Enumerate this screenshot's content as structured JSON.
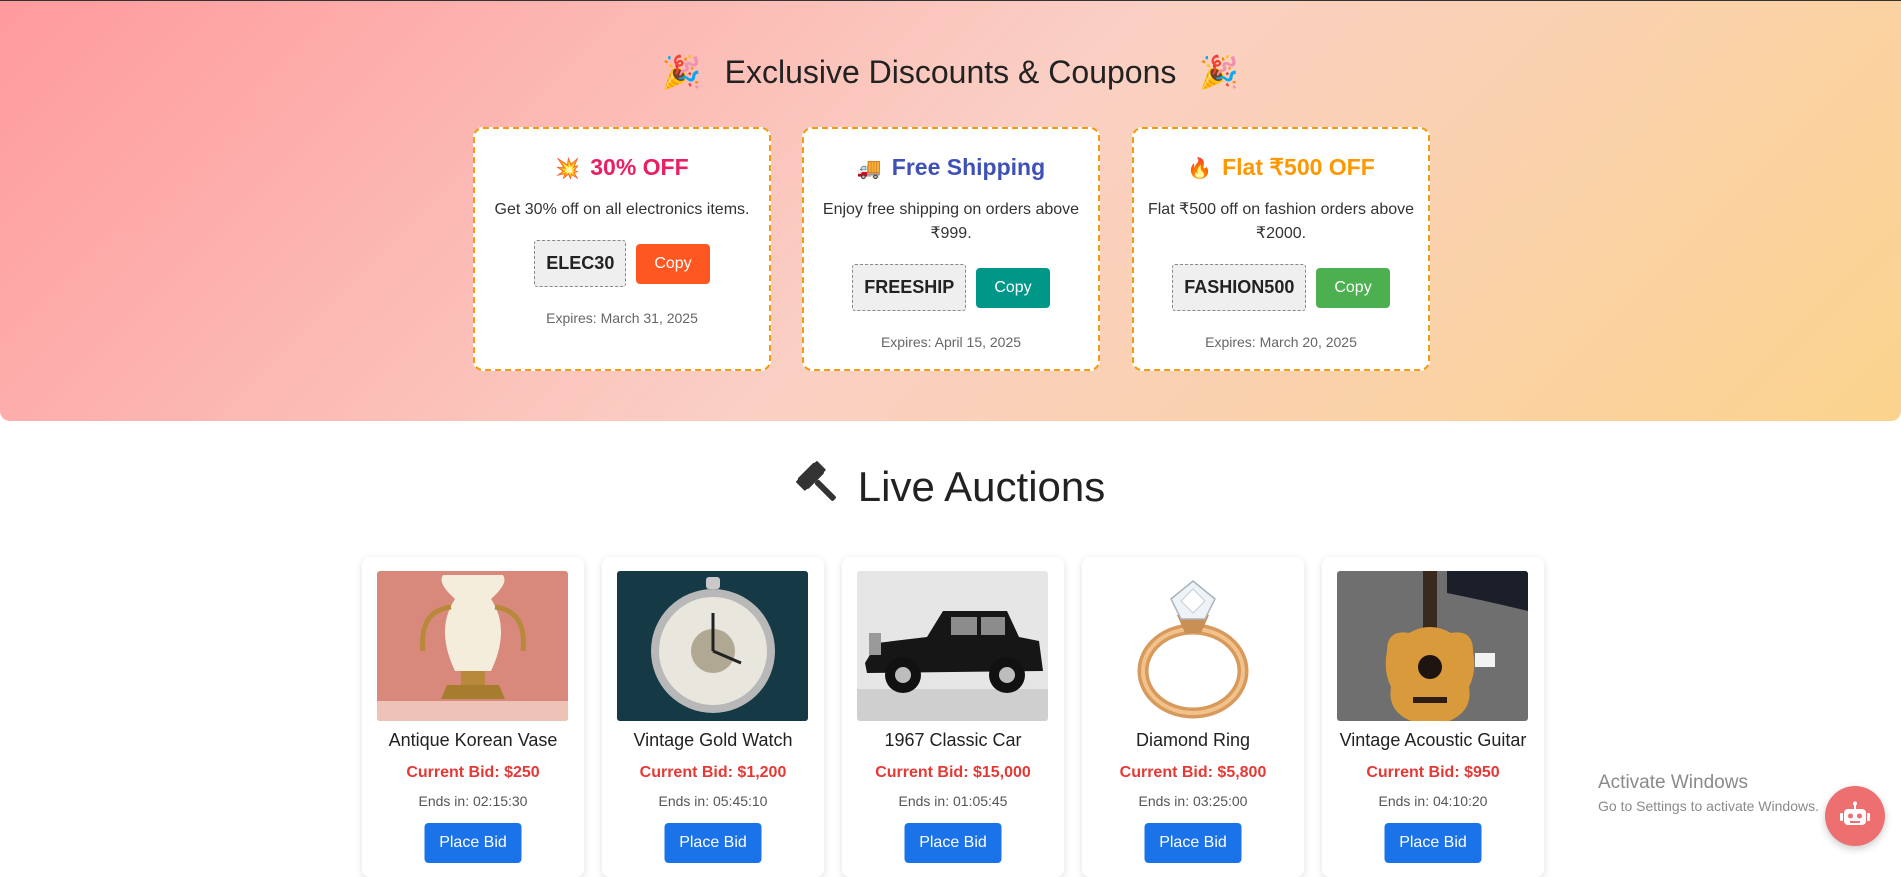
{
  "coupons": {
    "title": "Exclusive Discounts & Coupons",
    "title_emoji": "🎉",
    "items": [
      {
        "emoji": "💥",
        "title": "30% OFF",
        "description": "Get 30% off on all electronics items.",
        "code": "ELEC30",
        "copy_label": "Copy",
        "expiry": "Expires: March 31, 2025",
        "title_color": "#e91e63",
        "button_color": "#ff5722"
      },
      {
        "emoji": "🚚",
        "title": "Free Shipping",
        "description": "Enjoy free shipping on orders above ₹999.",
        "code": "FREESHIP",
        "copy_label": "Copy",
        "expiry": "Expires: April 15, 2025",
        "title_color": "#3f51b5",
        "button_color": "#009688"
      },
      {
        "emoji": "🔥",
        "title": "Flat ₹500 OFF",
        "description": "Flat ₹500 off on fashion orders above ₹2000.",
        "code": "FASHION500",
        "copy_label": "Copy",
        "expiry": "Expires: March 20, 2025",
        "title_color": "#ff9800",
        "button_color": "#4caf50"
      }
    ]
  },
  "auctions": {
    "title": "Live Auctions",
    "title_icon": "gavel-icon",
    "items": [
      {
        "name": "Antique Korean Vase",
        "bid": "Current Bid: $250",
        "ends": "Ends in: 02:15:30",
        "button": "Place Bid",
        "image": "vase-image"
      },
      {
        "name": "Vintage Gold Watch",
        "bid": "Current Bid: $1,200",
        "ends": "Ends in: 05:45:10",
        "button": "Place Bid",
        "image": "pocket-watch-image"
      },
      {
        "name": "1967 Classic Car",
        "bid": "Current Bid: $15,000",
        "ends": "Ends in: 01:05:45",
        "button": "Place Bid",
        "image": "classic-car-image"
      },
      {
        "name": "Diamond Ring",
        "bid": "Current Bid: $5,800",
        "ends": "Ends in: 03:25:00",
        "button": "Place Bid",
        "image": "diamond-ring-image"
      },
      {
        "name": "Vintage Acoustic Guitar",
        "bid": "Current Bid: $950",
        "ends": "Ends in: 04:10:20",
        "button": "Place Bid",
        "image": "guitar-image"
      }
    ]
  },
  "watermark": {
    "line1": "Activate Windows",
    "line2": "Go to Settings to activate Windows."
  },
  "chatbot": {
    "icon": "robot-icon",
    "color": "#ee6f6f"
  }
}
